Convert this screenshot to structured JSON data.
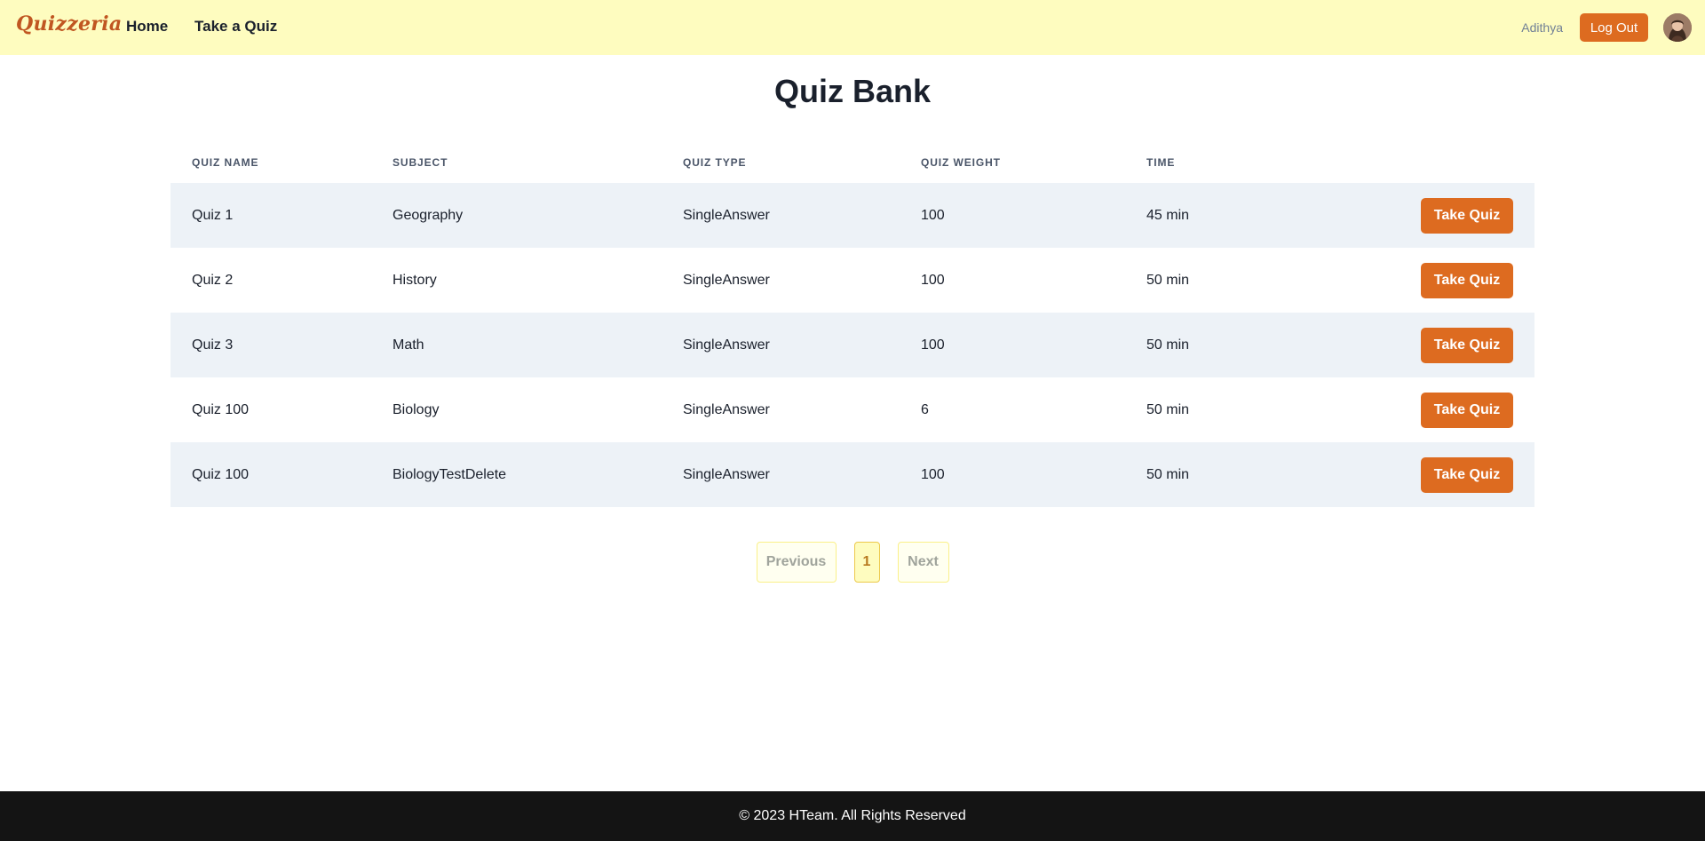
{
  "header": {
    "brand": "Quizzeria",
    "nav": [
      {
        "label": "Home"
      },
      {
        "label": "Take a Quiz"
      }
    ],
    "username": "Adithya",
    "logout_label": "Log Out",
    "avatar_icon": "user-avatar"
  },
  "main": {
    "title": "Quiz Bank",
    "table": {
      "columns": [
        "QUIZ NAME",
        "SUBJECT",
        "QUIZ TYPE",
        "QUIZ WEIGHT",
        "TIME"
      ],
      "rows": [
        {
          "name": "Quiz 1",
          "subject": "Geography",
          "type": "SingleAnswer",
          "weight": "100",
          "time": "45 min",
          "action": "Take Quiz"
        },
        {
          "name": "Quiz 2",
          "subject": "History",
          "type": "SingleAnswer",
          "weight": "100",
          "time": "50 min",
          "action": "Take Quiz"
        },
        {
          "name": "Quiz 3",
          "subject": "Math",
          "type": "SingleAnswer",
          "weight": "100",
          "time": "50 min",
          "action": "Take Quiz"
        },
        {
          "name": "Quiz 100",
          "subject": "Biology",
          "type": "SingleAnswer",
          "weight": "6",
          "time": "50 min",
          "action": "Take Quiz"
        },
        {
          "name": "Quiz 100",
          "subject": "BiologyTestDelete",
          "type": "SingleAnswer",
          "weight": "100",
          "time": "50 min",
          "action": "Take Quiz"
        }
      ]
    },
    "pagination": {
      "previous_label": "Previous",
      "current_page": "1",
      "next_label": "Next"
    }
  },
  "footer": {
    "text": "© 2023 HTeam. All Rights Reserved"
  },
  "colors": {
    "header_bg": "#fefcbf",
    "accent": "#dd6b20",
    "row_stripe": "#edf2f7",
    "footer_bg": "#141414"
  }
}
